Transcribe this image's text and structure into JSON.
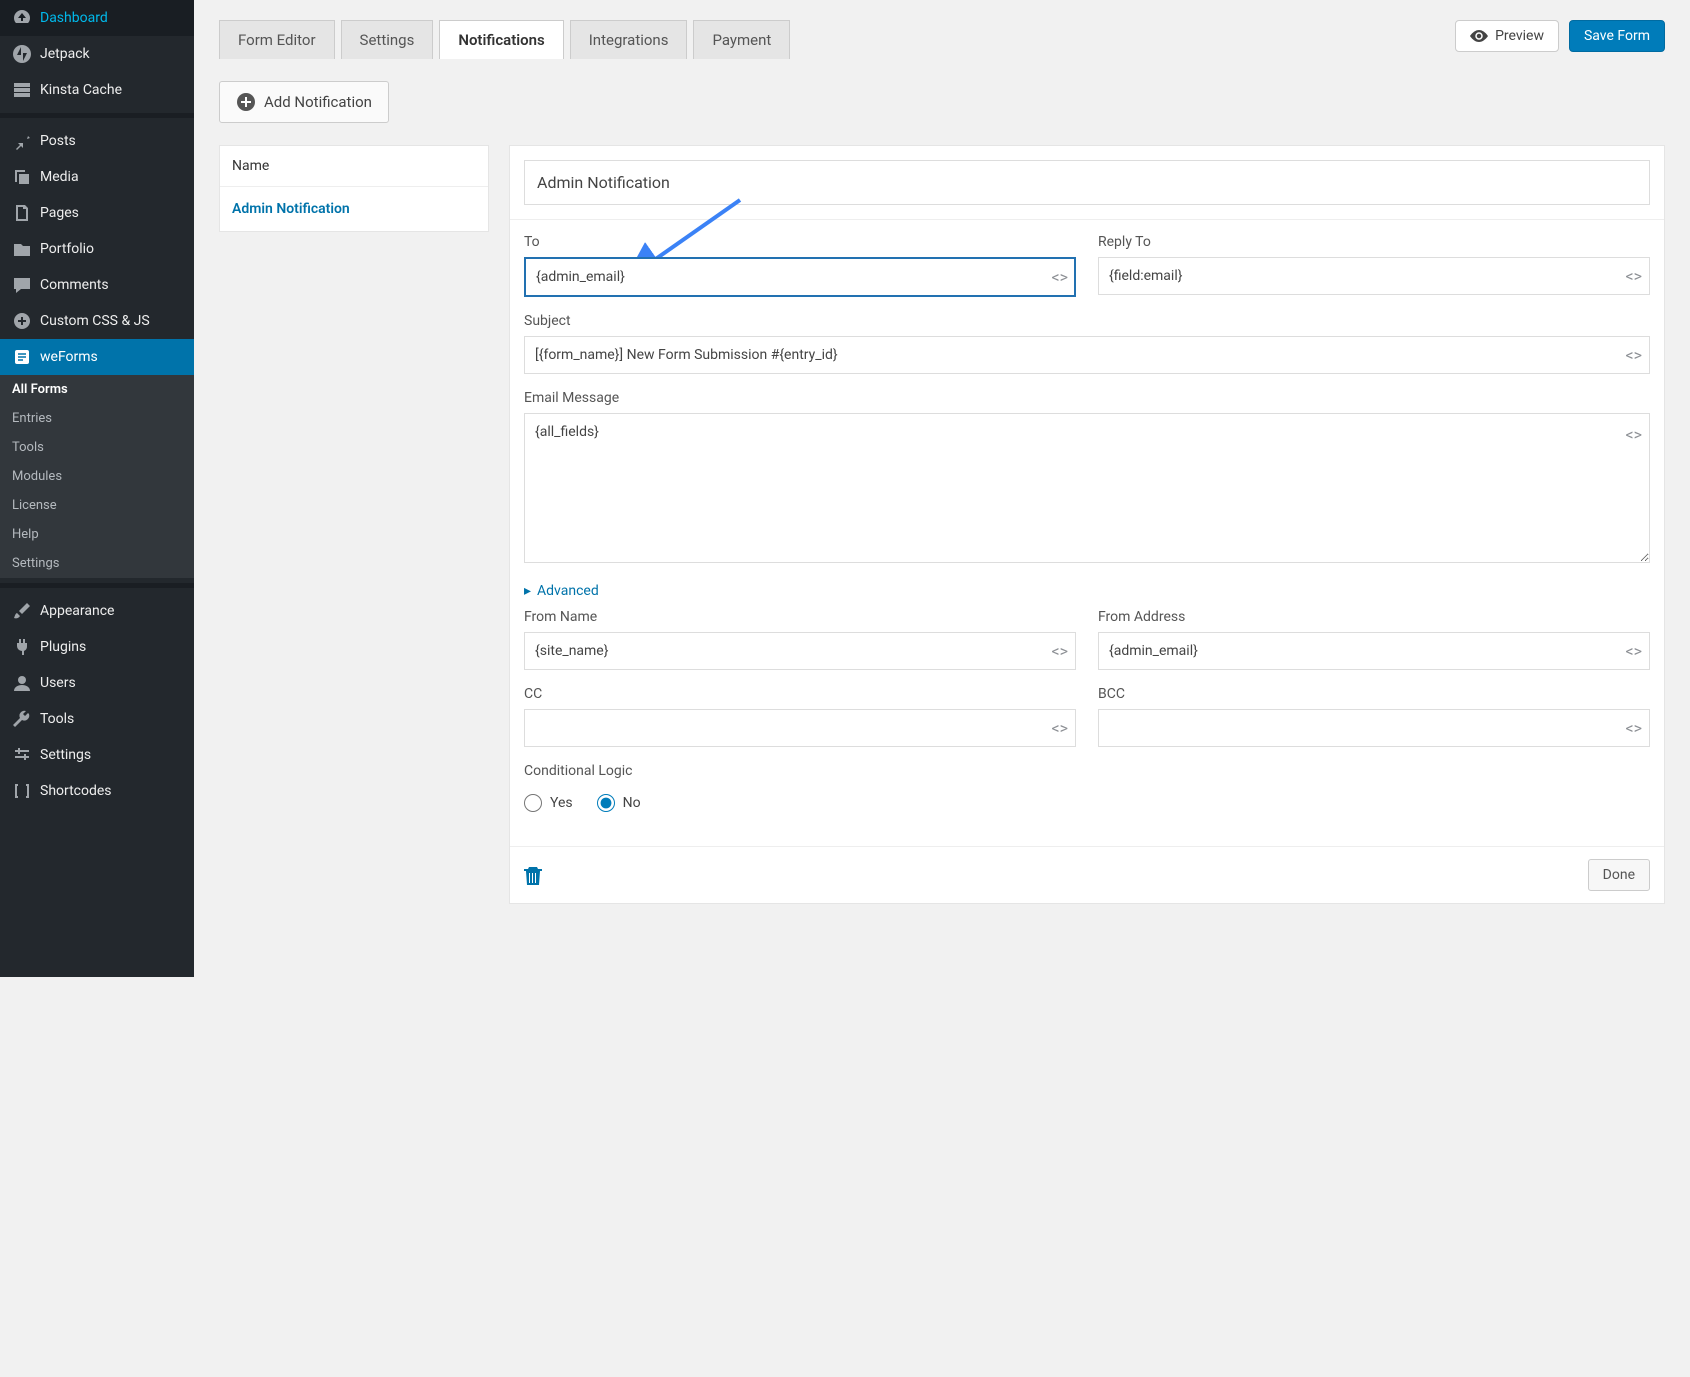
{
  "sidebar": {
    "items": [
      {
        "label": "Dashboard",
        "icon": "gauge"
      },
      {
        "label": "Jetpack",
        "icon": "jetpack"
      },
      {
        "label": "Kinsta Cache",
        "icon": "server"
      }
    ],
    "items2": [
      {
        "label": "Posts",
        "icon": "pin"
      },
      {
        "label": "Media",
        "icon": "media"
      },
      {
        "label": "Pages",
        "icon": "page"
      },
      {
        "label": "Portfolio",
        "icon": "portfolio"
      },
      {
        "label": "Comments",
        "icon": "comment"
      },
      {
        "label": "Custom CSS & JS",
        "icon": "pluscircle"
      },
      {
        "label": "weForms",
        "icon": "weforms",
        "active": true
      }
    ],
    "submenu": [
      {
        "label": "All Forms",
        "current": true
      },
      {
        "label": "Entries"
      },
      {
        "label": "Tools"
      },
      {
        "label": "Modules"
      },
      {
        "label": "License"
      },
      {
        "label": "Help"
      },
      {
        "label": "Settings"
      }
    ],
    "items3": [
      {
        "label": "Appearance",
        "icon": "brush"
      },
      {
        "label": "Plugins",
        "icon": "plug"
      },
      {
        "label": "Users",
        "icon": "user"
      },
      {
        "label": "Tools",
        "icon": "wrench"
      },
      {
        "label": "Settings",
        "icon": "sliders"
      },
      {
        "label": "Shortcodes",
        "icon": "brackets"
      }
    ]
  },
  "tabs": [
    "Form Editor",
    "Settings",
    "Notifications",
    "Integrations",
    "Payment"
  ],
  "active_tab": 2,
  "top_actions": {
    "preview": "Preview",
    "save": "Save Form"
  },
  "add_button": "Add Notification",
  "left_panel": {
    "header": "Name",
    "item": "Admin Notification"
  },
  "form": {
    "title": "Admin Notification",
    "to": {
      "label": "To",
      "value": "{admin_email}"
    },
    "reply_to": {
      "label": "Reply To",
      "value": "{field:email}"
    },
    "subject": {
      "label": "Subject",
      "value": "[{form_name}] New Form Submission #{entry_id}"
    },
    "message": {
      "label": "Email Message",
      "value": "{all_fields}"
    },
    "advanced": "Advanced",
    "from_name": {
      "label": "From Name",
      "value": "{site_name}"
    },
    "from_address": {
      "label": "From Address",
      "value": "{admin_email}"
    },
    "cc": {
      "label": "CC",
      "value": ""
    },
    "bcc": {
      "label": "BCC",
      "value": ""
    },
    "conditional": {
      "label": "Conditional Logic",
      "yes": "Yes",
      "no": "No",
      "selected": "no"
    },
    "done": "Done"
  }
}
